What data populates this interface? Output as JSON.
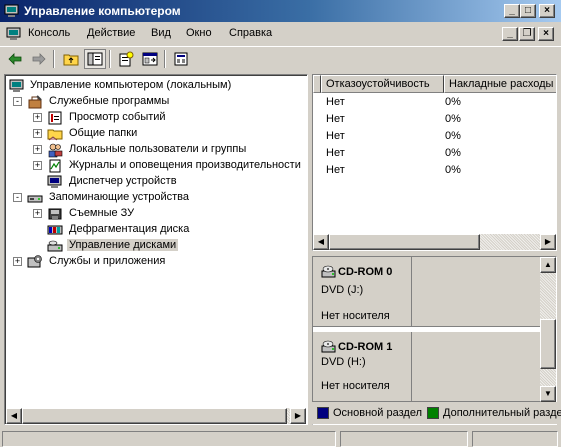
{
  "window": {
    "title": "Управление компьютером",
    "minimize": "_",
    "maximize": "□",
    "close": "×"
  },
  "mdi_controls": {
    "minimize": "_",
    "restore": "❐",
    "close": "×"
  },
  "menu": [
    "Консоль",
    "Действие",
    "Вид",
    "Окно",
    "Справка"
  ],
  "toolbar": {
    "icons": [
      "back-arrow-icon",
      "forward-arrow-icon",
      "up-folder-icon",
      "show-hide-tree-icon",
      "properties-icon",
      "export-list-icon",
      "help-icon"
    ]
  },
  "tree": {
    "root": "Управление компьютером (локальным)",
    "nodes": [
      {
        "label": "Служебные программы",
        "expander": "-"
      },
      {
        "label": "Просмотр событий",
        "expander": "+"
      },
      {
        "label": "Общие папки",
        "expander": "+"
      },
      {
        "label": "Локальные пользователи и группы",
        "expander": "+"
      },
      {
        "label": "Журналы и оповещения производительности",
        "expander": "+"
      },
      {
        "label": "Диспетчер устройств",
        "expander": ""
      },
      {
        "label": "Запоминающие устройства",
        "expander": "-"
      },
      {
        "label": "Съемные ЗУ",
        "expander": "+"
      },
      {
        "label": "Дефрагментация диска",
        "expander": ""
      },
      {
        "label": "Управление дисками",
        "expander": "",
        "selected": true
      },
      {
        "label": "Службы и приложения",
        "expander": "+"
      }
    ]
  },
  "list": {
    "columns": [
      "Отказоустойчивость",
      "Накладные расходы"
    ],
    "rows": [
      [
        "Нет",
        "0%"
      ],
      [
        "Нет",
        "0%"
      ],
      [
        "Нет",
        "0%"
      ],
      [
        "Нет",
        "0%"
      ],
      [
        "Нет",
        "0%"
      ]
    ]
  },
  "disks": [
    {
      "name": "CD-ROM 0",
      "type": "DVD (J:)",
      "status": "Нет носителя"
    },
    {
      "name": "CD-ROM 1",
      "type": "DVD (H:)",
      "status": "Нет носителя"
    }
  ],
  "legend": [
    {
      "label": "Основной раздел",
      "color": "#000080"
    },
    {
      "label": "Дополнительный раздел",
      "color": "#008000"
    }
  ],
  "colors": {
    "titlebar_start": "#0a246a",
    "titlebar_end": "#a6caf0",
    "face": "#d4d0c8"
  }
}
